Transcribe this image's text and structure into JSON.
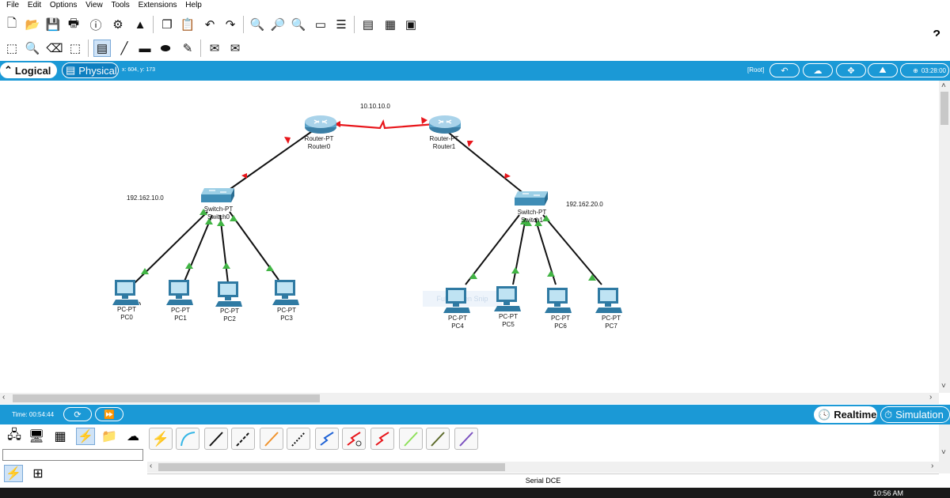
{
  "menu": [
    "File",
    "Edit",
    "Options",
    "View",
    "Tools",
    "Extensions",
    "Help"
  ],
  "toolbar": {
    "help_label": "?"
  },
  "tabs": {
    "logical": "Logical",
    "physical": "Physical"
  },
  "cursor_coords": "x: 604, y: 173",
  "root_label": "[Root]",
  "clock": "03:28:00",
  "networks": {
    "wan": "10.10.10.0",
    "lan0": "192.162.10.0",
    "lan1": "192.162.20.0"
  },
  "devices": {
    "router0": {
      "model": "Router-PT",
      "name": "Router0"
    },
    "router1": {
      "model": "Router-PT",
      "name": "Router1"
    },
    "switch0": {
      "model": "Switch-PT",
      "name": "Switch0"
    },
    "switch1": {
      "model": "Switch-PT",
      "name": "Switch1"
    },
    "pc0": {
      "model": "PC-PT",
      "name": "PC0"
    },
    "pc1": {
      "model": "PC-PT",
      "name": "PC1"
    },
    "pc2": {
      "model": "PC-PT",
      "name": "PC2"
    },
    "pc3": {
      "model": "PC-PT",
      "name": "PC3"
    },
    "pc4": {
      "model": "PC-PT",
      "name": "PC4"
    },
    "pc5": {
      "model": "PC-PT",
      "name": "PC5"
    },
    "pc6": {
      "model": "PC-PT",
      "name": "PC6"
    },
    "pc7": {
      "model": "PC-PT",
      "name": "PC7"
    }
  },
  "snip_overlay": "Full-screen Snip",
  "sim_bar": {
    "time": "Time: 00:54:44",
    "realtime": "Realtime",
    "simulation": "Simulation"
  },
  "status_text": "Serial DCE",
  "taskbar_time": "10:56 AM",
  "colors": {
    "accent": "#1b99d6",
    "serial_link": "#e8161b",
    "link_up": "#41b444",
    "link_down": "#e8161b"
  }
}
